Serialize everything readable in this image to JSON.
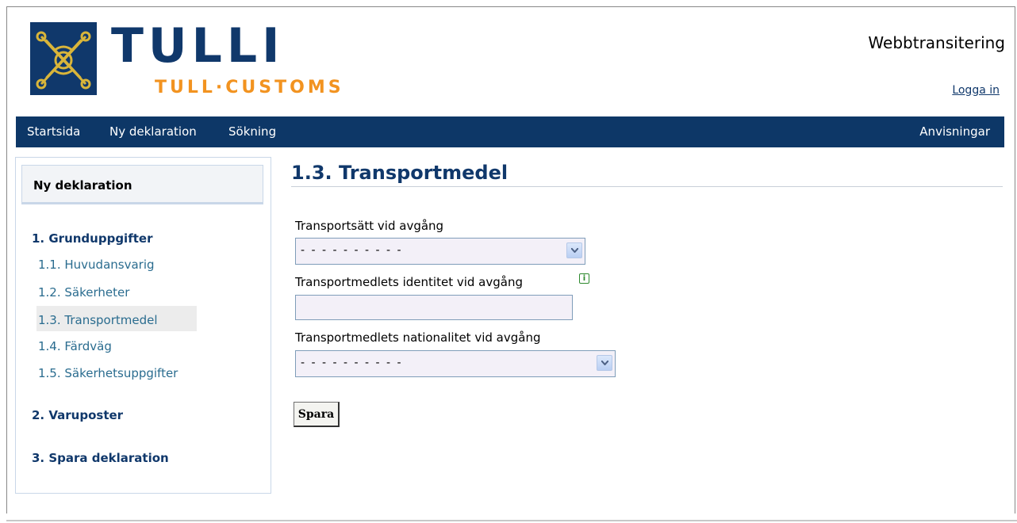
{
  "header": {
    "brand_main": "TULLI",
    "brand_sub": "TULL·CUSTOMS",
    "app_title": "Webbtransitering",
    "login_link": "Logga in"
  },
  "nav": {
    "items": [
      "Startsida",
      "Ny deklaration",
      "Sökning"
    ],
    "right_item": "Anvisningar"
  },
  "sidebar": {
    "title": "Ny deklaration",
    "groups": [
      {
        "label": "1. Grunduppgifter",
        "items": [
          "1.1. Huvudansvarig",
          "1.2. Säkerheter",
          "1.3. Transportmedel",
          "1.4. Färdväg",
          "1.5. Säkerhetsuppgifter"
        ]
      },
      {
        "label": "2. Varuposter"
      },
      {
        "label": "3. Spara deklaration"
      }
    ],
    "active_item": "1.3. Transportmedel"
  },
  "main": {
    "title": "1.3. Transportmedel",
    "fields": [
      {
        "label": "Transportsätt vid avgång",
        "type": "select",
        "value": "- - - - - - - - - -"
      },
      {
        "label": "Transportmedlets identitet vid avgång",
        "type": "text",
        "value": ""
      },
      {
        "label": "Transportmedlets nationalitet vid avgång",
        "type": "select",
        "value": "- - - - - - - - - -"
      }
    ],
    "info_icon_glyph": "i",
    "save_label": "Spara"
  },
  "colors": {
    "brand_navy": "#10386b",
    "brand_orange": "#f29320",
    "link_teal": "#2a6c8f",
    "field_bg": "#f3f0f8"
  }
}
